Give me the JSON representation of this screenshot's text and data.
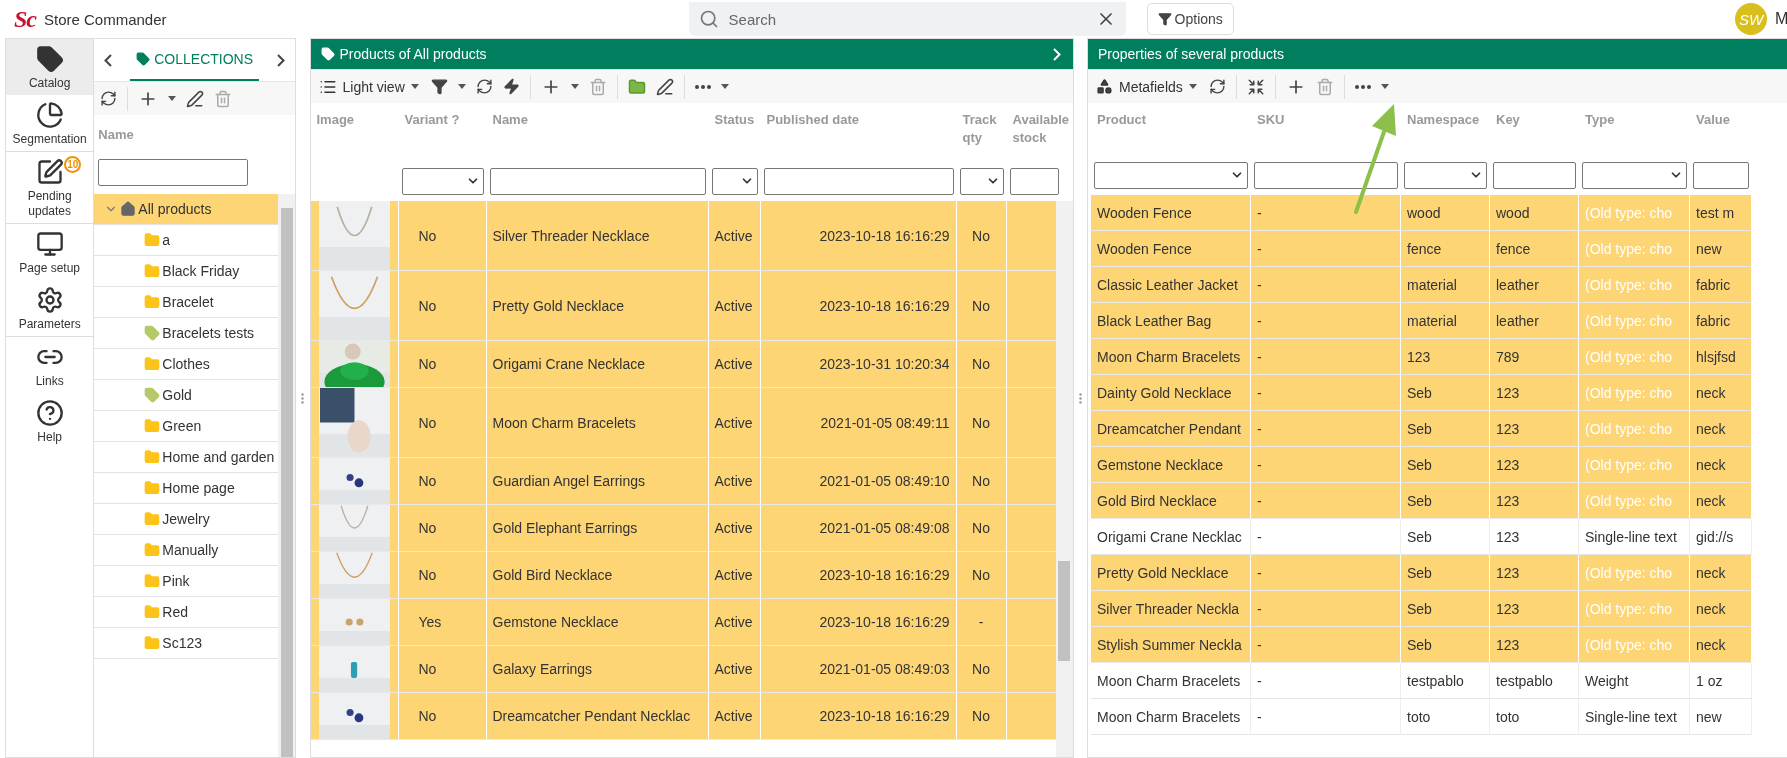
{
  "app": {
    "logo": "Sc",
    "title": "Store Commander"
  },
  "search": {
    "placeholder": "Search"
  },
  "options_button": "Options",
  "user": {
    "initials": "SW",
    "name": "M"
  },
  "nav": [
    {
      "label": "Catalog",
      "selected": true
    },
    {
      "label": "Segmentation",
      "selected": false
    },
    {
      "label": "Pending updates",
      "selected": false,
      "badge": "10"
    },
    {
      "label": "Page setup",
      "selected": false
    },
    {
      "label": "Parameters",
      "selected": false
    },
    {
      "label": "Links",
      "selected": false
    },
    {
      "label": "Help",
      "selected": false
    }
  ],
  "collections": {
    "tab": "COLLECTIONS",
    "column": "Name",
    "tree": [
      {
        "label": "All products",
        "kind": "home",
        "selected": true,
        "expanded": true,
        "children": [
          {
            "label": "a",
            "kind": "folder",
            "selected": false
          },
          {
            "label": "Black Friday",
            "kind": "folder",
            "selected": false
          },
          {
            "label": "Bracelet",
            "kind": "folder",
            "selected": false
          },
          {
            "label": "Bracelets tests",
            "kind": "tag",
            "selected": false
          },
          {
            "label": "Clothes",
            "kind": "folder",
            "selected": false
          },
          {
            "label": "Gold",
            "kind": "tag",
            "selected": false
          },
          {
            "label": "Green",
            "kind": "folder",
            "selected": false
          },
          {
            "label": "Home and garden",
            "kind": "folder",
            "selected": false
          },
          {
            "label": "Home page",
            "kind": "folder",
            "selected": false
          },
          {
            "label": "Jewelry",
            "kind": "folder",
            "selected": false
          },
          {
            "label": "Manually",
            "kind": "folder",
            "selected": false
          },
          {
            "label": "Pink",
            "kind": "folder",
            "selected": false
          },
          {
            "label": "Red",
            "kind": "folder",
            "selected": false
          },
          {
            "label": "Sc123",
            "kind": "folder",
            "selected": false
          }
        ]
      }
    ]
  },
  "products": {
    "title": "Products of All products",
    "view": "Light view",
    "columns": [
      {
        "label": "Image",
        "kind": "plain"
      },
      {
        "label": "Variant ?",
        "kind": "select"
      },
      {
        "label": "Name",
        "kind": "text"
      },
      {
        "label": "Status",
        "kind": "select"
      },
      {
        "label": "Published date",
        "kind": "text"
      },
      {
        "label": "Track qty",
        "kind": "select"
      },
      {
        "label": "Available stock",
        "kind": "text"
      }
    ],
    "rows": [
      {
        "variant": "No",
        "name": "Silver Threader Necklace",
        "status": "Active",
        "published": "2023-10-18 16:16:29",
        "track_qty": "No",
        "selected": true
      },
      {
        "variant": "No",
        "name": "Pretty Gold Necklace",
        "status": "Active",
        "published": "2023-10-18 16:16:29",
        "track_qty": "No",
        "selected": true
      },
      {
        "variant": "No",
        "name": "Origami Crane Necklace",
        "status": "Active",
        "published": "2023-10-31 10:20:34",
        "track_qty": "No",
        "selected": true
      },
      {
        "variant": "No",
        "name": "Moon Charm Bracelets",
        "status": "Active",
        "published": "2021-01-05 08:49:11",
        "track_qty": "No",
        "selected": true
      },
      {
        "variant": "No",
        "name": "Guardian Angel Earrings",
        "status": "Active",
        "published": "2021-01-05 08:49:10",
        "track_qty": "No",
        "selected": true
      },
      {
        "variant": "No",
        "name": "Gold Elephant Earrings",
        "status": "Active",
        "published": "2021-01-05 08:49:08",
        "track_qty": "No",
        "selected": true
      },
      {
        "variant": "No",
        "name": "Gold Bird Necklace",
        "status": "Active",
        "published": "2023-10-18 16:16:29",
        "track_qty": "No",
        "selected": true
      },
      {
        "variant": "Yes",
        "name": "Gemstone Necklace",
        "status": "Active",
        "published": "2023-10-18 16:16:29",
        "track_qty": "-",
        "selected": true
      },
      {
        "variant": "No",
        "name": "Galaxy Earrings",
        "status": "Active",
        "published": "2021-01-05 08:49:03",
        "track_qty": "No",
        "selected": true
      },
      {
        "variant": "No",
        "name": "Dreamcatcher Pendant Necklac",
        "status": "Active",
        "published": "2023-10-18 16:16:29",
        "track_qty": "No",
        "selected": true
      }
    ]
  },
  "properties": {
    "title": "Properties of several products",
    "view": "Metafields",
    "columns": [
      {
        "label": "Product",
        "kind": "select"
      },
      {
        "label": "SKU",
        "kind": "text"
      },
      {
        "label": "Namespace",
        "kind": "select"
      },
      {
        "label": "Key",
        "kind": "text"
      },
      {
        "label": "Type",
        "kind": "select"
      },
      {
        "label": "Value",
        "kind": "text"
      }
    ],
    "rows": [
      {
        "product": "Wooden Fence",
        "sku": "-",
        "namespace": "wood",
        "key": "wood",
        "type": "(Old type: cho",
        "value": "test m",
        "selected": true
      },
      {
        "product": "Wooden Fence",
        "sku": "-",
        "namespace": "fence",
        "key": "fence",
        "type": "(Old type: cho",
        "value": "new",
        "selected": true
      },
      {
        "product": "Classic Leather Jacket",
        "sku": "-",
        "namespace": "material",
        "key": "leather",
        "type": "(Old type: cho",
        "value": "fabric",
        "selected": true
      },
      {
        "product": "Black Leather Bag",
        "sku": "-",
        "namespace": "material",
        "key": "leather",
        "type": "(Old type: cho",
        "value": "fabric",
        "selected": true
      },
      {
        "product": "Moon Charm Bracelets",
        "sku": "-",
        "namespace": "123",
        "key": "789",
        "type": "(Old type: cho",
        "value": "hlsjfsd",
        "selected": true
      },
      {
        "product": "Dainty Gold Necklace",
        "sku": "-",
        "namespace": "Seb",
        "key": "123",
        "type": "(Old type: cho",
        "value": "neck",
        "selected": true
      },
      {
        "product": "Dreamcatcher Pendant",
        "sku": "-",
        "namespace": "Seb",
        "key": "123",
        "type": "(Old type: cho",
        "value": "neck",
        "selected": true
      },
      {
        "product": "Gemstone Necklace",
        "sku": "-",
        "namespace": "Seb",
        "key": "123",
        "type": "(Old type: cho",
        "value": "neck",
        "selected": true
      },
      {
        "product": "Gold Bird Necklace",
        "sku": "-",
        "namespace": "Seb",
        "key": "123",
        "type": "(Old type: cho",
        "value": "neck",
        "selected": true
      },
      {
        "product": "Origami Crane Necklac",
        "sku": "-",
        "namespace": "Seb",
        "key": "123",
        "type": "Single-line text",
        "value": "gid://s",
        "selected": false
      },
      {
        "product": "Pretty Gold Necklace",
        "sku": "-",
        "namespace": "Seb",
        "key": "123",
        "type": "(Old type: cho",
        "value": "neck",
        "selected": true
      },
      {
        "product": "Silver Threader Neckla",
        "sku": "-",
        "namespace": "Seb",
        "key": "123",
        "type": "(Old type: cho",
        "value": "neck",
        "selected": true
      },
      {
        "product": "Stylish Summer Neckla",
        "sku": "-",
        "namespace": "Seb",
        "key": "123",
        "type": "(Old type: cho",
        "value": "neck",
        "selected": true
      },
      {
        "product": "Moon Charm Bracelets",
        "sku": "-",
        "namespace": "testpablo",
        "key": "testpablo",
        "type": "Weight",
        "value": "1 oz",
        "selected": false
      },
      {
        "product": "Moon Charm Bracelets",
        "sku": "-",
        "namespace": "toto",
        "key": "toto",
        "type": "Single-line text",
        "value": "new",
        "selected": false
      }
    ]
  }
}
